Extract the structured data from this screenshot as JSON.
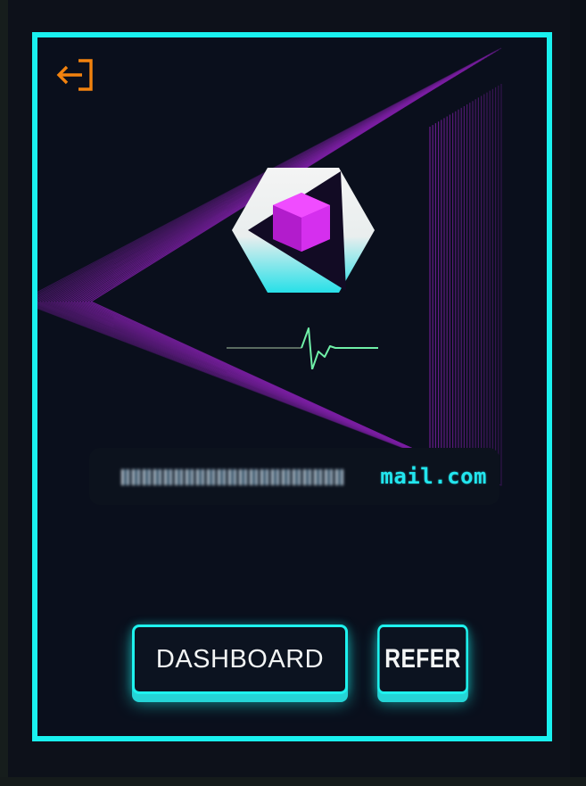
{
  "card": {
    "email": "mail.com",
    "email_masked": true
  },
  "buttons": {
    "dashboard_label": "DASHBOARD",
    "refer_label": "REFER"
  },
  "icons": {
    "logout": "logout-icon",
    "logo": "hexagon-cube-logo-icon",
    "pulse": "heartbeat-pulse-icon"
  },
  "colors": {
    "accent": "#19f1ef",
    "logout_icon": "#f2820e",
    "cube": "#e733ff",
    "background": "#0a0f1c",
    "decor_lines": "#7b1fa2"
  }
}
